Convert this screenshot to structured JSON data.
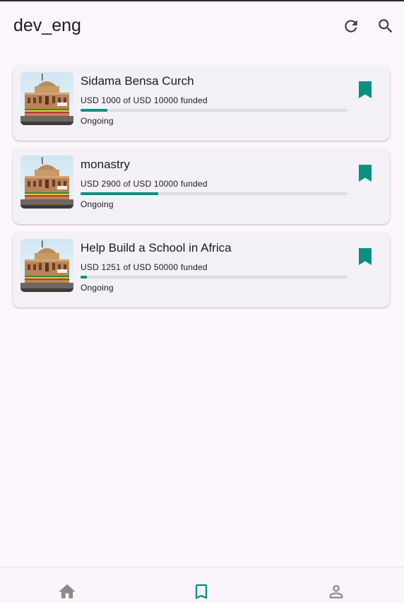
{
  "appbar": {
    "title": "dev_eng",
    "actions": [
      {
        "icon": "refresh-icon"
      },
      {
        "icon": "search-icon"
      }
    ]
  },
  "projects": [
    {
      "title": "Sidama Bensa Curch",
      "funded_text": "USD 1000 of USD 10000 funded",
      "progress": 0.1,
      "status": "Ongoing",
      "bookmarked": true
    },
    {
      "title": "monastry",
      "funded_text": "USD 2900 of USD 10000 funded",
      "progress": 0.29,
      "status": "Ongoing",
      "bookmarked": true
    },
    {
      "title": "Help Build a School in Africa",
      "funded_text": "USD 1251 of USD 50000 funded",
      "progress": 0.025,
      "status": "Ongoing",
      "bookmarked": true
    }
  ],
  "bottom_nav": {
    "items": [
      {
        "icon": "home-icon",
        "active": false
      },
      {
        "icon": "bookmark-icon",
        "active": true
      },
      {
        "icon": "person-icon",
        "active": false
      }
    ]
  },
  "colors": {
    "accent": "#0b9080",
    "background": "#fdf7fd",
    "card": "#f4f1f6",
    "inactive_icon": "#8a8a8a"
  }
}
